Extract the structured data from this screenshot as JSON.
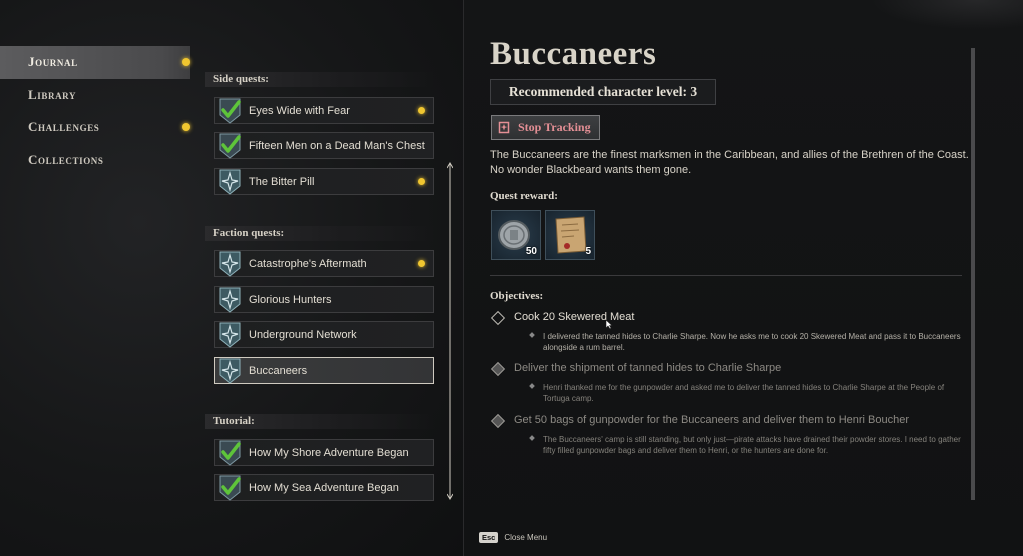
{
  "nav": {
    "items": [
      {
        "label": "Journal",
        "active": true,
        "dot": true
      },
      {
        "label": "Library",
        "active": false,
        "dot": false
      },
      {
        "label": "Challenges",
        "active": false,
        "dot": true
      },
      {
        "label": "Collections",
        "active": false,
        "dot": false
      }
    ]
  },
  "sections": {
    "side": "Side quests:",
    "faction": "Faction quests:",
    "tutorial": "Tutorial:"
  },
  "quests": {
    "side": [
      {
        "label": "Eyes Wide with Fear",
        "completed": true,
        "dot": true
      },
      {
        "label": "Fifteen Men on a Dead Man's Chest",
        "completed": true,
        "dot": false
      },
      {
        "label": "The Bitter Pill",
        "completed": false,
        "dot": true
      }
    ],
    "faction": [
      {
        "label": "Catastrophe's Aftermath",
        "completed": false,
        "dot": true
      },
      {
        "label": "Glorious Hunters",
        "completed": false,
        "dot": false
      },
      {
        "label": "Underground Network",
        "completed": false,
        "dot": false
      },
      {
        "label": "Buccaneers",
        "completed": false,
        "dot": false,
        "selected": true
      }
    ],
    "tutorial": [
      {
        "label": "How My Shore Adventure Began",
        "completed": true,
        "dot": false
      },
      {
        "label": "How My Sea Adventure Began",
        "completed": true,
        "dot": false
      }
    ]
  },
  "detail": {
    "title": "Buccaneers",
    "recommended_level": "Recommended character level: 3",
    "stop_tracking": "Stop Tracking",
    "description": "The Buccaneers are the finest marksmen in the Caribbean, and allies of the Brethren of the Coast. No wonder Blackbeard wants them gone.",
    "reward_label": "Quest reward:",
    "rewards": [
      {
        "icon": "silver-coin-icon",
        "count": "50"
      },
      {
        "icon": "treasure-map-icon",
        "count": "5"
      }
    ],
    "objectives_label": "Objectives:",
    "objectives": [
      {
        "title": "Cook 20 Skewered Meat",
        "done": false,
        "note": "I delivered the tanned hides to Charlie Sharpe. Now he asks me to cook 20 Skewered Meat and pass it to Buccaneers alongside a rum barrel."
      },
      {
        "title": "Deliver the shipment of tanned hides to Charlie Sharpe",
        "done": true,
        "note": "Henri thanked me for the gunpowder and asked me to deliver the tanned hides to Charlie Sharpe at the People of Tortuga camp."
      },
      {
        "title": "Get 50 bags of gunpowder for the Buccaneers and deliver them to Henri Boucher",
        "done": true,
        "note": "The Buccaneers' camp is still standing, but only just—pirate attacks have drained their powder stores. I need to gather fifty filled gunpowder bags and deliver them to Henri, or the hunters are done for."
      }
    ]
  },
  "footer": {
    "key": "Esc",
    "label": "Close Menu"
  },
  "colors": {
    "accent_dot": "#f0c630",
    "check": "#5ec43a",
    "stop_text": "#e48f95"
  }
}
